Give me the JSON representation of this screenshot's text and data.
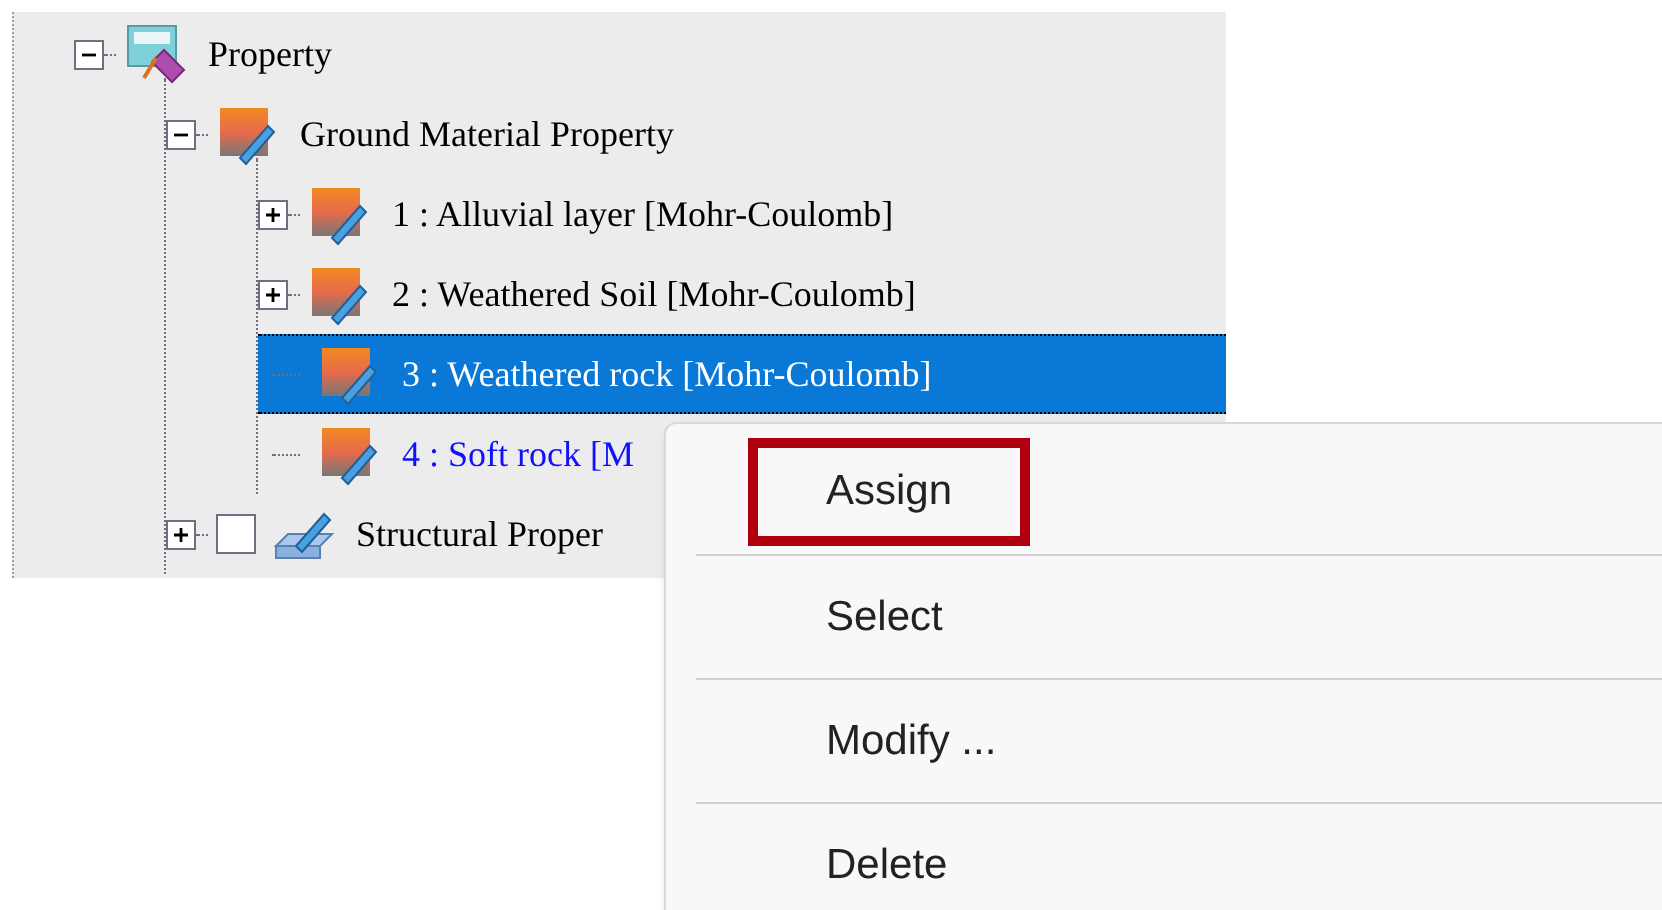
{
  "tree": [
    {
      "label": "Property",
      "kind": "property",
      "expanded": true,
      "children": [
        {
          "label": "Ground Material Property",
          "kind": "material",
          "expanded": true,
          "children": [
            {
              "label": "1 : Alluvial layer [Mohr-Coulomb]",
              "kind": "material",
              "expanded": false,
              "selected": false,
              "current": false
            },
            {
              "label": "2 : Weathered Soil [Mohr-Coulomb]",
              "kind": "material",
              "expanded": false,
              "selected": false,
              "current": false
            },
            {
              "label": "3 : Weathered rock [Mohr-Coulomb]",
              "kind": "material",
              "selected": true,
              "current": false
            },
            {
              "label": "4 : Soft rock [M",
              "kind": "material",
              "selected": false,
              "current": true
            }
          ]
        },
        {
          "label": "Structural Proper",
          "kind": "structural",
          "expanded": false,
          "checked": false
        }
      ]
    }
  ],
  "context_menu": [
    {
      "label": "Assign",
      "highlighted": true
    },
    {
      "label": "Select",
      "highlighted": false
    },
    {
      "label": "Modify ...",
      "highlighted": false
    },
    {
      "label": "Delete",
      "highlighted": false
    }
  ]
}
